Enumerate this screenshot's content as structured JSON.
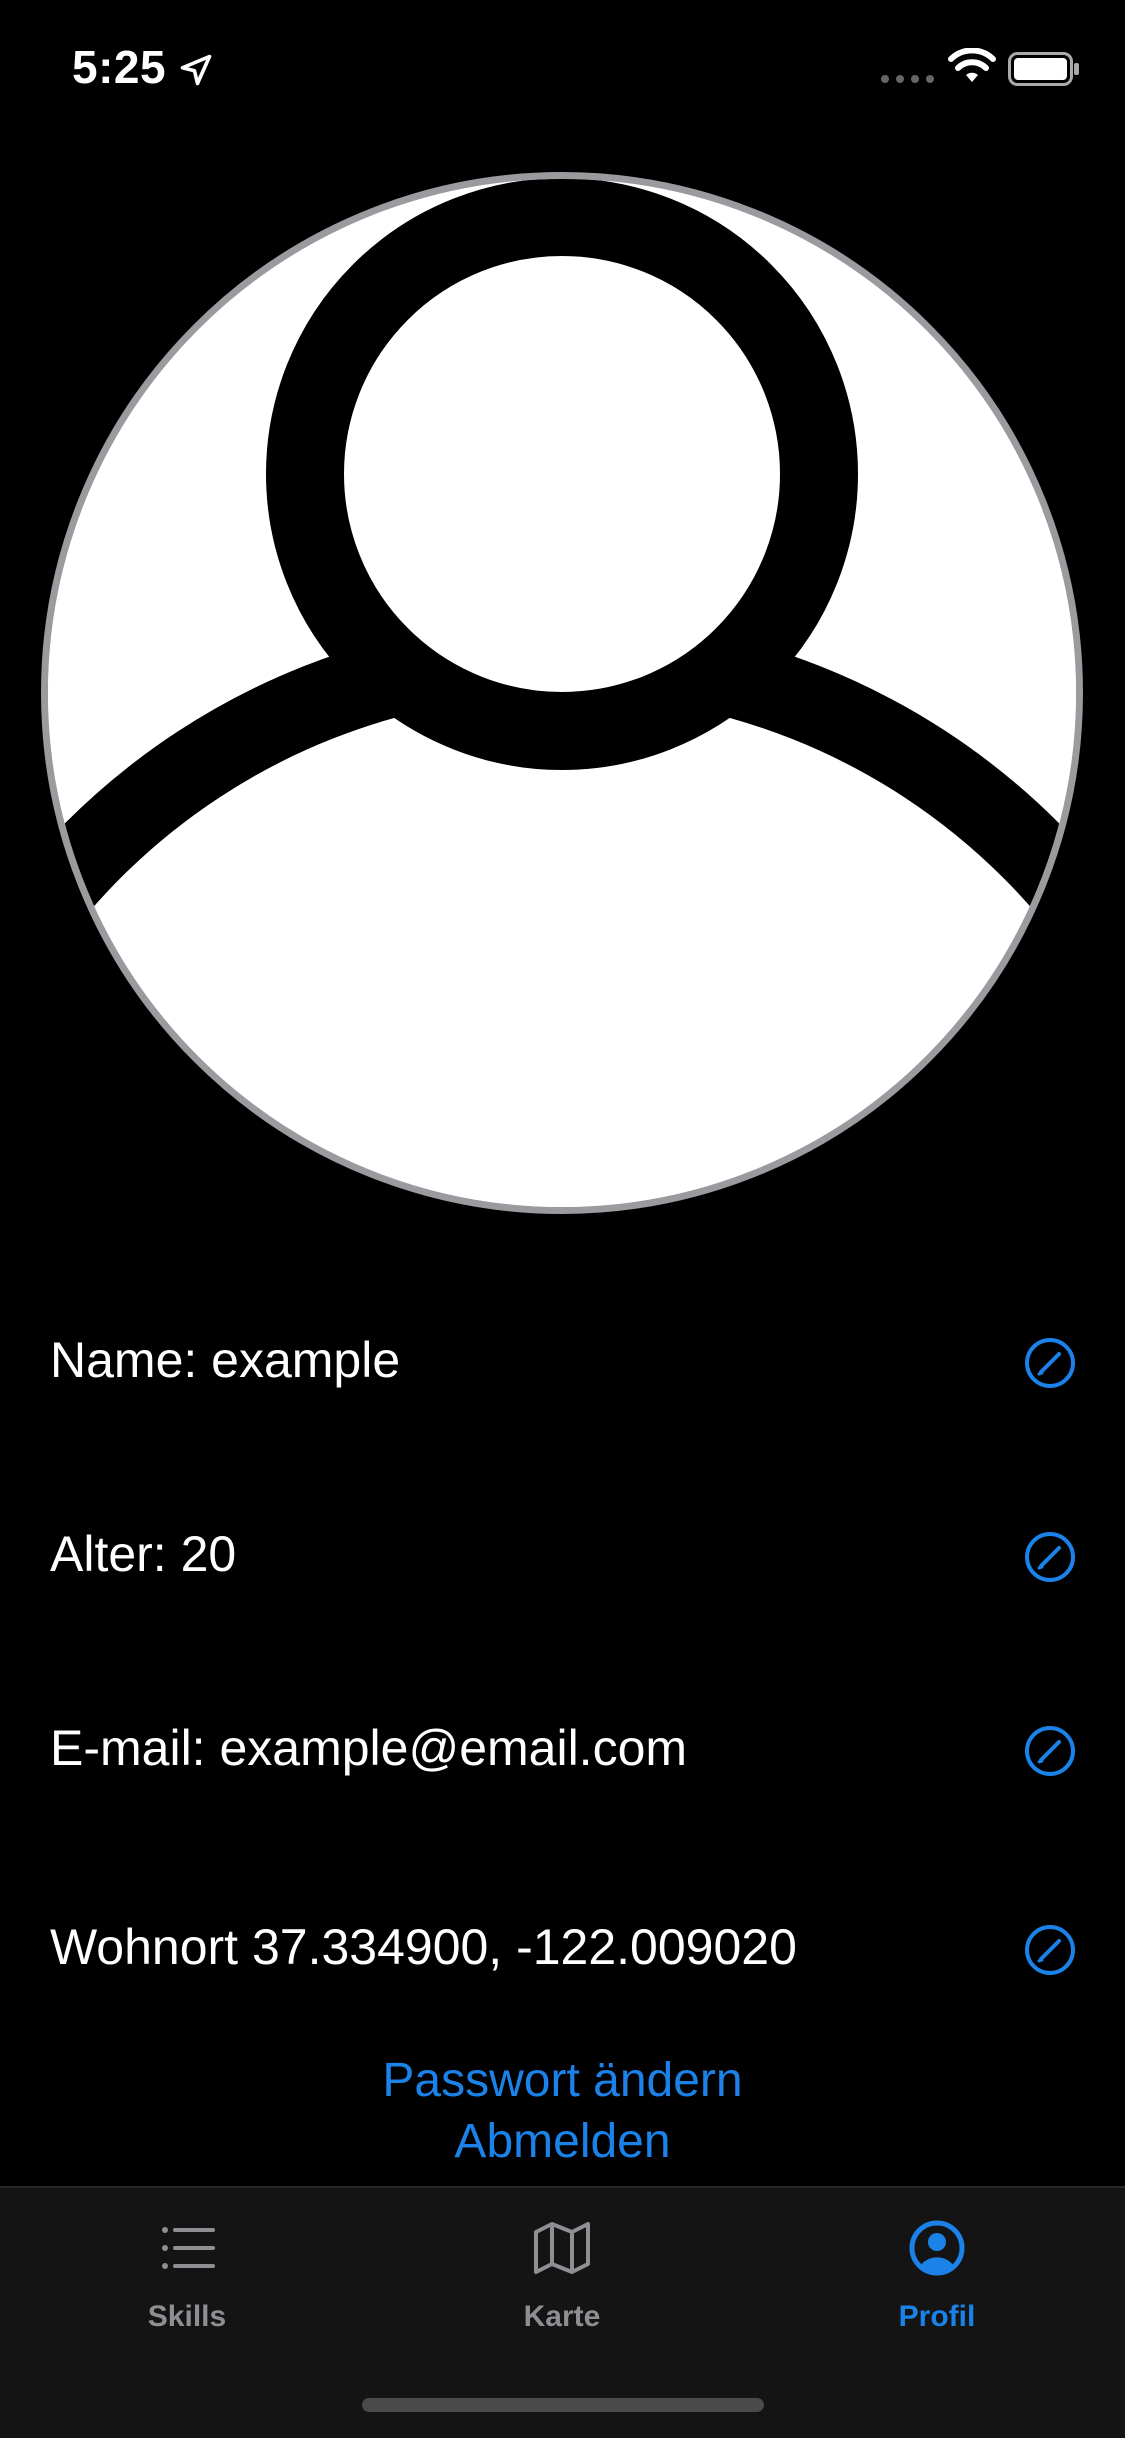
{
  "status_bar": {
    "time": "5:25"
  },
  "profile": {
    "rows": [
      {
        "label": "Name: example"
      },
      {
        "label": "Alter: 20"
      },
      {
        "label": "E-mail: example@email.com"
      },
      {
        "label": "Wohnort 37.334900, -122.009020"
      }
    ],
    "change_password_label": "Passwort ändern",
    "logout_label": "Abmelden"
  },
  "tab_bar": {
    "tabs": [
      {
        "label": "Skills",
        "icon": "list-icon",
        "active": false
      },
      {
        "label": "Karte",
        "icon": "map-icon",
        "active": false
      },
      {
        "label": "Profil",
        "icon": "person-circle-icon",
        "active": true
      }
    ]
  },
  "colors": {
    "accent": "#1a82e8",
    "background": "#000000",
    "tab_bar_background": "#141414",
    "inactive_tab": "#8e8e93"
  }
}
